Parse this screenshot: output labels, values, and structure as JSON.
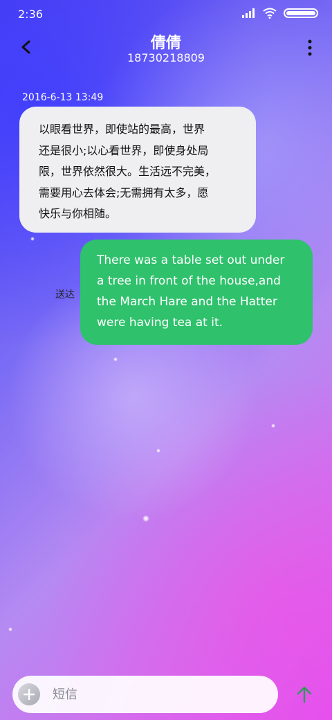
{
  "status_bar": {
    "time": "2:36",
    "battery_level": 1.0
  },
  "header": {
    "contact_name": "倩倩",
    "phone_number": "18730218809"
  },
  "messages": [
    {
      "direction": "incoming",
      "timestamp": "2016-6-13 13:49",
      "lines": [
        "以眼看世界，即使站的最高，世界",
        "还是很小;以心看世界，即使身处局",
        "限，世界依然很大。生活远不完美，",
        "需要用心去体会;无需拥有太多，愿",
        "快乐与你相随。"
      ]
    },
    {
      "direction": "outgoing",
      "status": "送达",
      "lines": [
        "There was a table set out under",
        "a tree in front of the house,and",
        "the March Hare and the Hatter",
        "were having tea at it."
      ]
    }
  ],
  "composer": {
    "placeholder": "短信",
    "value": ""
  },
  "colors": {
    "outgoing_bubble": "#2fc16c",
    "incoming_bubble": "#efeff2",
    "send_icon": "#2e9a55"
  },
  "icons": [
    "back-arrow-icon",
    "more-vertical-icon",
    "signal-icon",
    "wifi-icon",
    "battery-icon",
    "plus-icon",
    "send-arrow-icon"
  ]
}
